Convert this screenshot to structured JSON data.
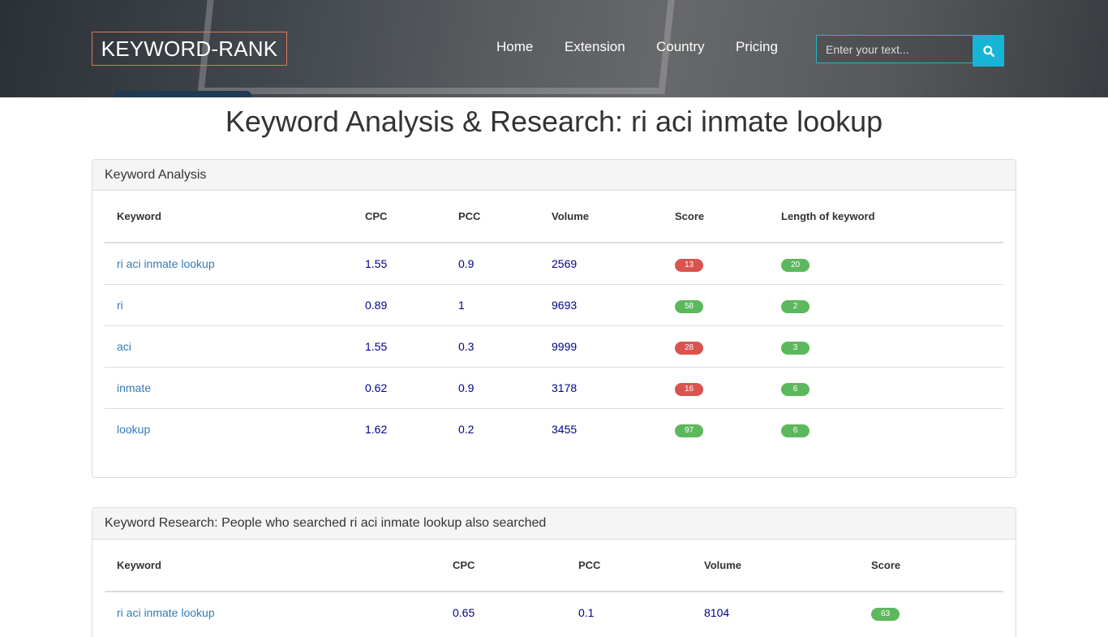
{
  "header": {
    "brand": "KEYWORD-RANK",
    "nav": [
      "Home",
      "Extension",
      "Country",
      "Pricing"
    ],
    "search_placeholder": "Enter your text..."
  },
  "page_title": "Keyword Analysis & Research: ri aci inmate lookup",
  "analysis": {
    "heading": "Keyword Analysis",
    "columns": [
      "Keyword",
      "CPC",
      "PCC",
      "Volume",
      "Score",
      "Length of keyword"
    ],
    "rows": [
      {
        "keyword": "ri aci inmate lookup",
        "cpc": "1.55",
        "pcc": "0.9",
        "volume": "2569",
        "score": "13",
        "score_color": "#d9534f",
        "length": "20",
        "length_color": "#5cb85c"
      },
      {
        "keyword": "ri",
        "cpc": "0.89",
        "pcc": "1",
        "volume": "9693",
        "score": "58",
        "score_color": "#5cb85c",
        "length": "2",
        "length_color": "#5cb85c"
      },
      {
        "keyword": "aci",
        "cpc": "1.55",
        "pcc": "0.3",
        "volume": "9999",
        "score": "28",
        "score_color": "#d9534f",
        "length": "3",
        "length_color": "#5cb85c"
      },
      {
        "keyword": "inmate",
        "cpc": "0.62",
        "pcc": "0.9",
        "volume": "3178",
        "score": "16",
        "score_color": "#d9534f",
        "length": "6",
        "length_color": "#5cb85c"
      },
      {
        "keyword": "lookup",
        "cpc": "1.62",
        "pcc": "0.2",
        "volume": "3455",
        "score": "97",
        "score_color": "#5cb85c",
        "length": "6",
        "length_color": "#5cb85c"
      }
    ]
  },
  "research": {
    "heading": "Keyword Research: People who searched ri aci inmate lookup also searched",
    "columns": [
      "Keyword",
      "CPC",
      "PCC",
      "Volume",
      "Score"
    ],
    "rows": [
      {
        "keyword": "ri aci inmate lookup",
        "cpc": "0.65",
        "pcc": "0.1",
        "volume": "8104",
        "score": "63",
        "score_color": "#5cb85c"
      }
    ]
  }
}
